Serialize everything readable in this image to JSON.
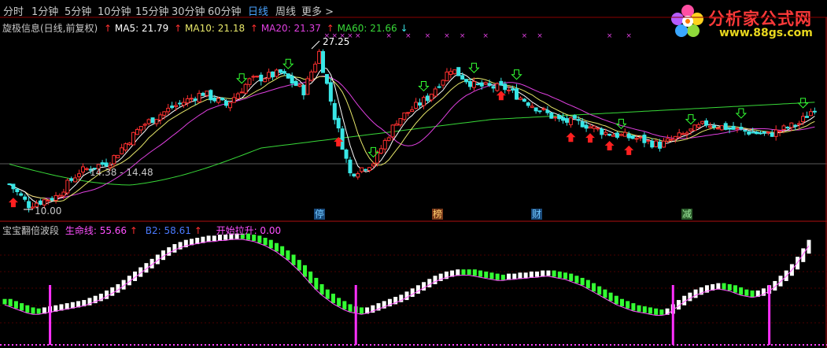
{
  "toolbar": {
    "items": [
      "分时",
      "1分钟",
      "5分钟",
      "10分钟",
      "15分钟",
      "30分钟",
      "60分钟",
      "日线",
      "周线",
      "更多 >"
    ],
    "active": "日线"
  },
  "logo": {
    "title": "分析家公式网",
    "url": "www.88gs.com"
  },
  "top_panel": {
    "title": "旋极信息(日线,前复权)",
    "ma": [
      {
        "label": "MA5: 21.79",
        "color": "#ffffff"
      },
      {
        "label": "MA10: 21.18",
        "color": "#e8e86a"
      },
      {
        "label": "MA20: 21.37",
        "color": "#e040e0"
      },
      {
        "label": "MA60: 21.66",
        "color": "#38d838"
      }
    ],
    "annotations": {
      "high": "27.25",
      "range": "14.38 - 14.48",
      "low": "10.00"
    },
    "event_markers": [
      "停",
      "榜",
      "财",
      "减"
    ]
  },
  "bottom_panel": {
    "title": "宝宝翻倍波段",
    "items": [
      {
        "label": "生命线: 55.66",
        "color": "#ff50ff"
      },
      {
        "label": "B2: 58.61",
        "color": "#4a7aff"
      },
      {
        "label": "开始拉升: 0.00",
        "color": "#ff50ff"
      }
    ]
  },
  "colors": {
    "up": "#ff3030",
    "down": "#39e6e6",
    "ma5": "#ffffff",
    "ma10": "#e8e86a",
    "ma20": "#e040e0",
    "ma60": "#38d838",
    "rise": "#ffffff",
    "fall": "#33ff33",
    "life_line": "#ff50ff"
  },
  "chart_data": [
    {
      "type": "candlestick",
      "title": "旋极信息(日线,前复权)",
      "price_range": [
        10.0,
        27.25
      ],
      "indicators": [
        "MA5",
        "MA10",
        "MA20",
        "MA60"
      ],
      "key_prices": {
        "high": 27.25,
        "low": 10.0,
        "range_low": 14.38,
        "range_high": 14.48
      }
    },
    {
      "type": "bar",
      "title": "宝宝翻倍波段",
      "y_range": [
        0,
        100
      ],
      "series": [
        {
          "name": "生命线",
          "last": 55.66
        },
        {
          "name": "B2",
          "last": 58.61
        },
        {
          "name": "开始拉升",
          "last": 0.0
        }
      ],
      "values": [
        38,
        36,
        34,
        32,
        30,
        29,
        29,
        30,
        31,
        32,
        33,
        34,
        35,
        36,
        37,
        39,
        41,
        43,
        46,
        49,
        52,
        56,
        60,
        64,
        68,
        72,
        76,
        80,
        84,
        87,
        90,
        92,
        94,
        95,
        96,
        97,
        98,
        98,
        99,
        99,
        100,
        100,
        100,
        99,
        98,
        96,
        94,
        91,
        88,
        84,
        80,
        75,
        70,
        64,
        58,
        52,
        47,
        43,
        39,
        36,
        33,
        31,
        30,
        29,
        30,
        32,
        34,
        36,
        38,
        40,
        42,
        45,
        48,
        51,
        54,
        57,
        60,
        62,
        64,
        65,
        66,
        66,
        66,
        65,
        64,
        63,
        62,
        61,
        61,
        62,
        62,
        63,
        63,
        64,
        64,
        65,
        65,
        64,
        63,
        62,
        60,
        58,
        56,
        53,
        50,
        47,
        44,
        41,
        38,
        36,
        34,
        32,
        31,
        30,
        29,
        28,
        28,
        29,
        33,
        37,
        41,
        44,
        47,
        49,
        51,
        52,
        53,
        52,
        51,
        49,
        47,
        46,
        45,
        46,
        48,
        51,
        55,
        60,
        65,
        71,
        78,
        86,
        94
      ],
      "up": [
        0,
        0,
        0,
        0,
        0,
        0,
        0,
        1,
        1,
        1,
        1,
        1,
        1,
        1,
        1,
        1,
        1,
        1,
        1,
        1,
        1,
        1,
        1,
        1,
        1,
        1,
        1,
        1,
        1,
        1,
        1,
        1,
        1,
        1,
        1,
        1,
        1,
        1,
        1,
        1,
        1,
        1,
        0,
        0,
        0,
        0,
        0,
        0,
        0,
        0,
        0,
        0,
        0,
        0,
        0,
        0,
        0,
        0,
        0,
        0,
        0,
        0,
        0,
        0,
        1,
        1,
        1,
        1,
        1,
        1,
        1,
        1,
        1,
        1,
        1,
        1,
        1,
        1,
        1,
        1,
        1,
        0,
        0,
        0,
        0,
        0,
        0,
        0,
        0,
        1,
        1,
        1,
        1,
        1,
        1,
        1,
        1,
        0,
        0,
        0,
        0,
        0,
        0,
        0,
        0,
        0,
        0,
        0,
        0,
        0,
        0,
        0,
        0,
        0,
        0,
        0,
        0,
        1,
        1,
        1,
        1,
        1,
        1,
        1,
        1,
        1,
        1,
        0,
        0,
        0,
        0,
        0,
        0,
        1,
        1,
        1,
        1,
        1,
        1,
        1,
        1,
        1,
        1
      ],
      "markers_at": [
        8,
        62,
        118,
        135
      ]
    }
  ]
}
